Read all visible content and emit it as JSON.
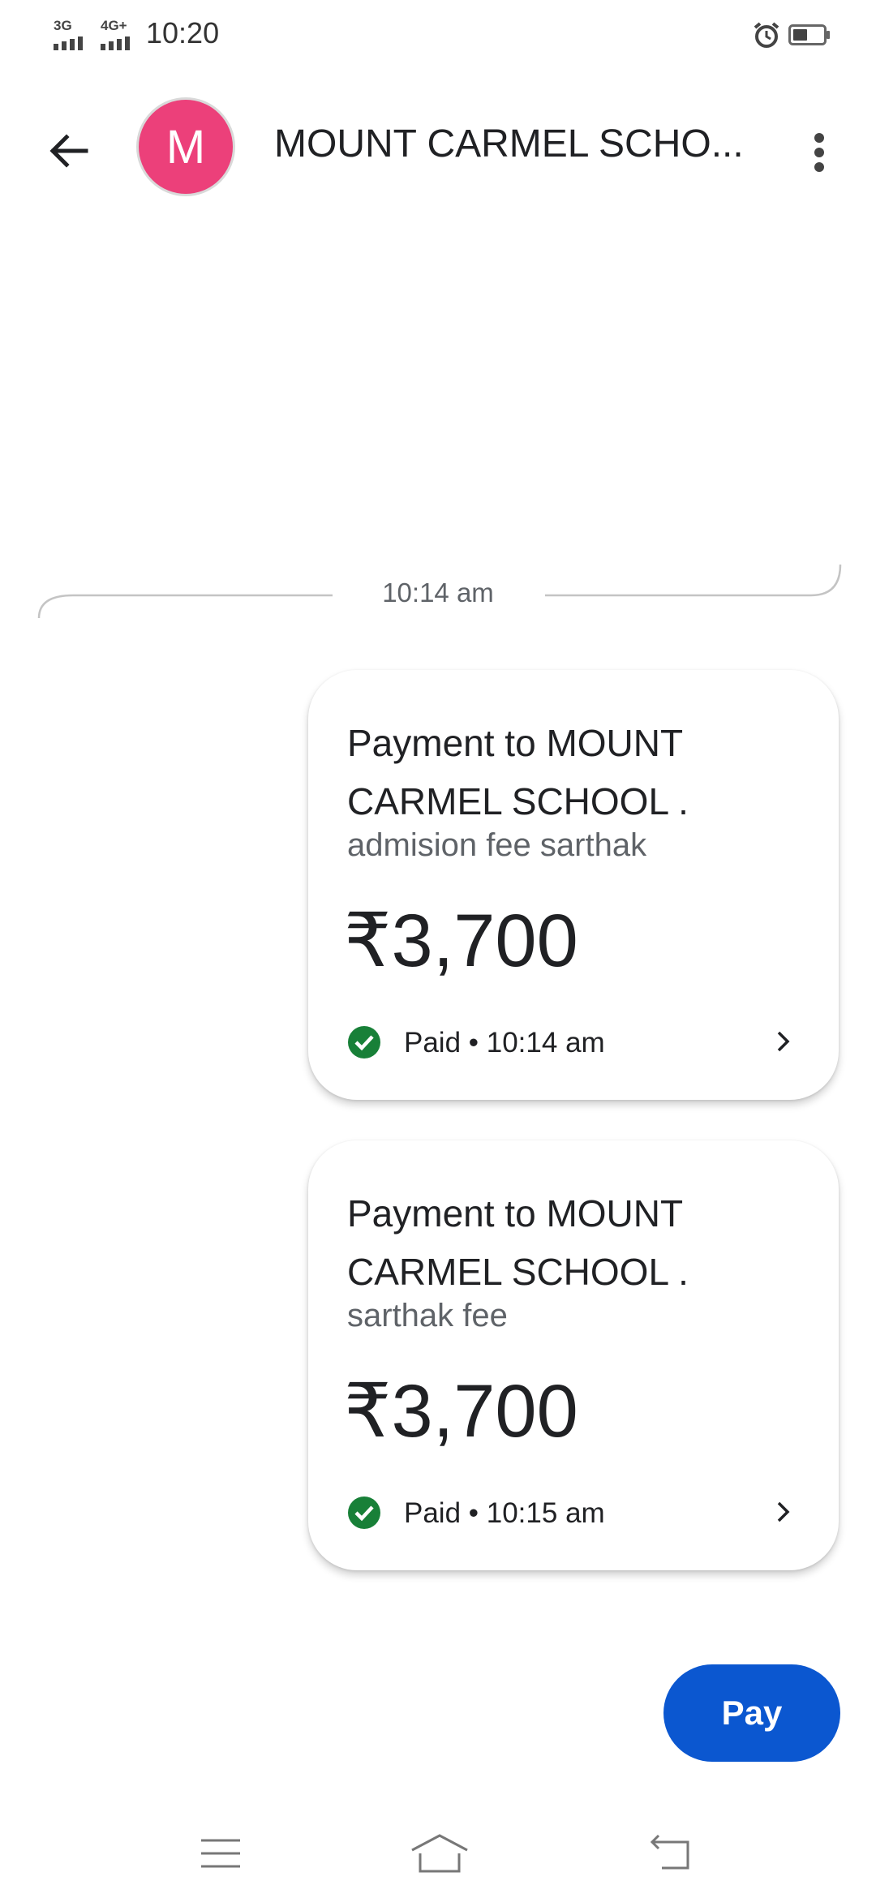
{
  "status_bar": {
    "network_1": "3G",
    "network_2": "4G+",
    "time": "10:20",
    "icons": [
      "signal-icon",
      "alarm-icon",
      "battery-icon"
    ]
  },
  "header": {
    "avatar_letter": "M",
    "avatar_color": "#ec407a",
    "title": "MOUNT CARMEL SCHO...",
    "icons": [
      "back-arrow-icon",
      "more-vert-icon"
    ]
  },
  "conversation": {
    "timestamp": "10:14 am",
    "payments": [
      {
        "payee": "Payment to MOUNT CARMEL SCHOOL .",
        "note": "admision fee sarthak",
        "amount": "₹3,700",
        "status": "Paid • 10:14 am",
        "status_color": "#188038"
      },
      {
        "payee": "Payment to MOUNT CARMEL SCHOOL .",
        "note": "sarthak fee",
        "amount": "₹3,700",
        "status": "Paid • 10:15 am",
        "status_color": "#188038"
      }
    ]
  },
  "actions": {
    "pay_label": "Pay",
    "pay_color": "#0b57d0"
  },
  "nav_bar": {
    "icons": [
      "menu-icon",
      "home-icon",
      "back-icon"
    ]
  }
}
